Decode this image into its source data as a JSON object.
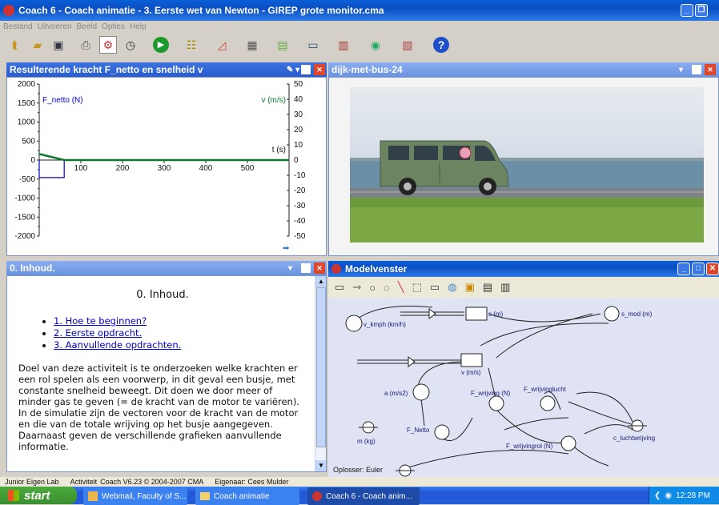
{
  "app": {
    "title": "Coach 6 - Coach animatie - 3. Eerste wet van Newton - GIREP grote monitor.cma",
    "menu": [
      "Bestand",
      "Uitvoeren",
      "Beeld",
      "Opties",
      "Help"
    ]
  },
  "chart_panel": {
    "title": "Resulterende kracht F_netto en snelheid v"
  },
  "chart_data": {
    "type": "line",
    "title": "",
    "xlabel": "t (s)",
    "ylabel_left": "F_netto (N)",
    "ylabel_right": "v (m/s)",
    "xlim": [
      0,
      600
    ],
    "ylim_left": [
      -2000,
      2000
    ],
    "ylim_right": [
      -50,
      50
    ],
    "x_ticks": [
      "100",
      "200",
      "300",
      "400",
      "500"
    ],
    "y_left_ticks": [
      "2000",
      "1500",
      "1000",
      "500",
      "0",
      "-500",
      "-1000",
      "-1500",
      "-2000"
    ],
    "y_right_ticks": [
      "50",
      "40",
      "30",
      "20",
      "10",
      "0",
      "-10",
      "-20",
      "-30",
      "-40",
      "-50"
    ],
    "series": [
      {
        "name": "F_netto (N)",
        "axis": "left",
        "color": "#0000cc",
        "x": [
          0,
          0,
          60,
          60,
          600
        ],
        "y": [
          0,
          -460,
          -460,
          0,
          0
        ]
      },
      {
        "name": "v (m/s)",
        "axis": "right",
        "color": "#0a7a2a",
        "x": [
          0,
          60,
          600
        ],
        "y": [
          4,
          0,
          0
        ]
      }
    ]
  },
  "animation_panel": {
    "title": "dijk-met-bus-24"
  },
  "content_panel": {
    "title": "0. Inhoud.",
    "heading": "0. Inhoud.",
    "links": [
      "1. Hoe te beginnen?",
      "2. Eerste opdracht.",
      "3. Aanvullende opdrachten."
    ],
    "paragraph1": "Doel van deze activiteit is te onderzoeken welke krachten er een rol spelen als een voorwerp, in dit geval een busje, met constante snelheid beweegt. Dit doen we door meer of minder gas te geven (= de kracht van de motor te variëren).",
    "paragraph2": "In de simulatie zijn de vectoren voor de kracht van de motor en die van de totale wrijving op het busje aangegeven. Daarnaast geven de verschillende grafieken aanvullende informatie."
  },
  "model_panel": {
    "title": "Modelvenster",
    "solver": "Oplosser: Euler",
    "nodes": {
      "s": "s (m)",
      "s_mod": "s_mod (m)",
      "v_kmph": "v_kmph (km/h)",
      "v": "v (m/s)",
      "a": "a (m/s2)",
      "F_wrijving": "F_wrijving (N)",
      "F_wrijvinglucht": "F_wrijvinglucht",
      "m": "m (kg)",
      "F_Netto": "F_Netto",
      "c_luchtwrijving": "c_luchtwrijving",
      "F_wrijvingrol": "F_wrijvingrol (N)"
    }
  },
  "statusbar": {
    "lab": "Junior Eigen Lab",
    "activity": "Activiteit",
    "version": "Coach V6.23 © 2004-2007 CMA",
    "owner": "Eigenaar: Cees Mulder"
  },
  "taskbar": {
    "start": "start",
    "tasks": [
      "Webmail, Faculty of S...",
      "Coach animatie",
      "Coach 6 - Coach anim..."
    ],
    "clock": "12:28 PM"
  }
}
